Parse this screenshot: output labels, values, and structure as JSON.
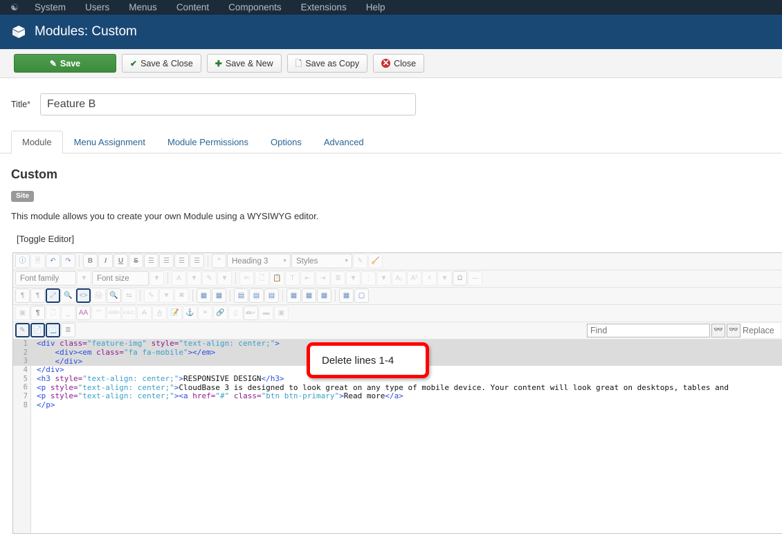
{
  "topbar": {
    "logo_icon": "joomla-logo-icon",
    "items": [
      {
        "label": "System"
      },
      {
        "label": "Users"
      },
      {
        "label": "Menus"
      },
      {
        "label": "Content"
      },
      {
        "label": "Components"
      },
      {
        "label": "Extensions"
      },
      {
        "label": "Help"
      }
    ]
  },
  "header": {
    "icon": "cube-icon",
    "title": "Modules: Custom",
    "bg": "#1a4875"
  },
  "toolbar": {
    "save_label": "Save",
    "save_close_label": "Save & Close",
    "save_new_label": "Save & New",
    "save_copy_label": "Save as Copy",
    "close_label": "Close",
    "save_bg": "#3d8b3d"
  },
  "title_field": {
    "label": "Title",
    "required_mark": "*",
    "value": "Feature B",
    "placeholder": ""
  },
  "tabs": [
    {
      "label": "Module",
      "active": true
    },
    {
      "label": "Menu Assignment",
      "active": false
    },
    {
      "label": "Module Permissions",
      "active": false
    },
    {
      "label": "Options",
      "active": false
    },
    {
      "label": "Advanced",
      "active": false
    }
  ],
  "module": {
    "heading": "Custom",
    "badge": "Site",
    "description": "This module allows you to create your own Module using a WYSIWYG editor.",
    "toggle_editor": "[Toggle Editor]"
  },
  "editor_toolbar": {
    "row1": {
      "buttons": [
        "help-icon",
        "new-document-icon",
        "undo-icon",
        "redo-icon",
        "bold-icon",
        "italic-icon",
        "underline-icon",
        "strikethrough-icon",
        "align-left-icon",
        "align-center-icon",
        "align-right-icon",
        "align-justify-icon",
        "blockquote-icon"
      ],
      "format_select": "Heading 3",
      "styles_select": "Styles",
      "eraser_icon": "remove-format-icon",
      "brush_icon": "clean-styles-icon"
    },
    "row2": {
      "fontfamily_select": "Font family",
      "fontsize_select": "Font size",
      "buttons": [
        "text-color-icon",
        "background-color-icon",
        "cut-icon",
        "copy-icon",
        "paste-icon",
        "paste-as-text-icon",
        "outdent-icon",
        "indent-icon",
        "numbered-list-icon",
        "bulleted-list-icon",
        "subscript-icon",
        "superscript-icon",
        "remove-format-icon",
        "special-character-icon",
        "horizontal-rule-icon"
      ]
    },
    "row3": {
      "buttons": [
        "ltr-icon",
        "rtl-icon",
        "fullscreen-icon",
        "preview-icon",
        "source-code-icon",
        "print-icon",
        "search-icon",
        "replace-icon",
        "edit-icon",
        "image-remove-icon",
        "table-icon",
        "table-props-icon",
        "row-before-icon",
        "row-after-icon",
        "delete-row-icon",
        "col-before-icon",
        "col-after-icon",
        "delete-col-icon",
        "grid-icon",
        "frame-icon"
      ]
    },
    "row4": {
      "buttons": [
        "visual-aid-icon",
        "paragraph-icon",
        "pagebreak-icon",
        "readmore-icon",
        "font-select-icon",
        "quote-icon",
        "abbr-icon",
        "acronym-icon",
        "del-icon",
        "ins-icon",
        "note-icon",
        "anchor-icon",
        "unlink-icon",
        "link-icon",
        "media-icon",
        "spellcheck-icon",
        "hr-icon",
        "layer-icon"
      ]
    },
    "row5": {
      "buttons": [
        "article-edit-icon",
        "article-icon",
        "article-list-icon",
        "indent-list-icon"
      ]
    }
  },
  "find_replace": {
    "find_placeholder": "Find",
    "replace_placeholder": "Replace",
    "find_value": "",
    "replace_value": "",
    "find_prev_icon": "binoculars-down-icon",
    "find_next_icon": "binoculars-up-icon"
  },
  "code": {
    "lines": [
      {
        "n": "1",
        "selected": true,
        "parts": [
          {
            "t": "<div ",
            "c": "tg"
          },
          {
            "t": "class=",
            "c": "at"
          },
          {
            "t": "\"feature-img\" ",
            "c": "vl"
          },
          {
            "t": "style=",
            "c": "at"
          },
          {
            "t": "\"text-align: center;\"",
            "c": "vl"
          },
          {
            "t": ">",
            "c": "tg"
          }
        ]
      },
      {
        "n": "2",
        "selected": true,
        "parts": [
          {
            "t": "    <div><em ",
            "c": "tg"
          },
          {
            "t": "class=",
            "c": "at"
          },
          {
            "t": "\"fa fa-mobile\"",
            "c": "vl"
          },
          {
            "t": "></em>",
            "c": "tg"
          }
        ]
      },
      {
        "n": "3",
        "selected": true,
        "parts": [
          {
            "t": "    </div>",
            "c": "tg"
          }
        ]
      },
      {
        "n": "4",
        "selected": false,
        "parts": [
          {
            "t": "</div>",
            "c": "tg"
          }
        ]
      },
      {
        "n": "5",
        "selected": false,
        "parts": [
          {
            "t": "<h3 ",
            "c": "tg"
          },
          {
            "t": "style=",
            "c": "at"
          },
          {
            "t": "\"text-align: center;\"",
            "c": "vl"
          },
          {
            "t": ">",
            "c": "tg"
          },
          {
            "t": "RESPONSIVE DESIGN",
            "c": "tx"
          },
          {
            "t": "</h3>",
            "c": "tg"
          }
        ]
      },
      {
        "n": "6",
        "selected": false,
        "parts": [
          {
            "t": "<p ",
            "c": "tg"
          },
          {
            "t": "style=",
            "c": "at"
          },
          {
            "t": "\"text-align: center;\"",
            "c": "vl"
          },
          {
            "t": ">",
            "c": "tg"
          },
          {
            "t": "CloudBase 3 is designed to look great on any type of mobile device. Your content will look great on desktops, tables and",
            "c": "tx"
          }
        ]
      },
      {
        "n": "7",
        "selected": false,
        "parts": [
          {
            "t": "<p ",
            "c": "tg"
          },
          {
            "t": "style=",
            "c": "at"
          },
          {
            "t": "\"text-align: center;\"",
            "c": "vl"
          },
          {
            "t": "><a ",
            "c": "tg"
          },
          {
            "t": "href=",
            "c": "at"
          },
          {
            "t": "\"#\" ",
            "c": "vl"
          },
          {
            "t": "class=",
            "c": "at"
          },
          {
            "t": "\"btn btn-primary\"",
            "c": "vl"
          },
          {
            "t": ">",
            "c": "tg"
          },
          {
            "t": "Read more",
            "c": "tx"
          },
          {
            "t": "</a>",
            "c": "tg"
          }
        ]
      },
      {
        "n": "8",
        "selected": false,
        "parts": [
          {
            "t": "</p>",
            "c": "tg"
          }
        ]
      }
    ]
  },
  "annotation": {
    "text": "Delete lines 1-4",
    "border_color": "#ff0000"
  }
}
